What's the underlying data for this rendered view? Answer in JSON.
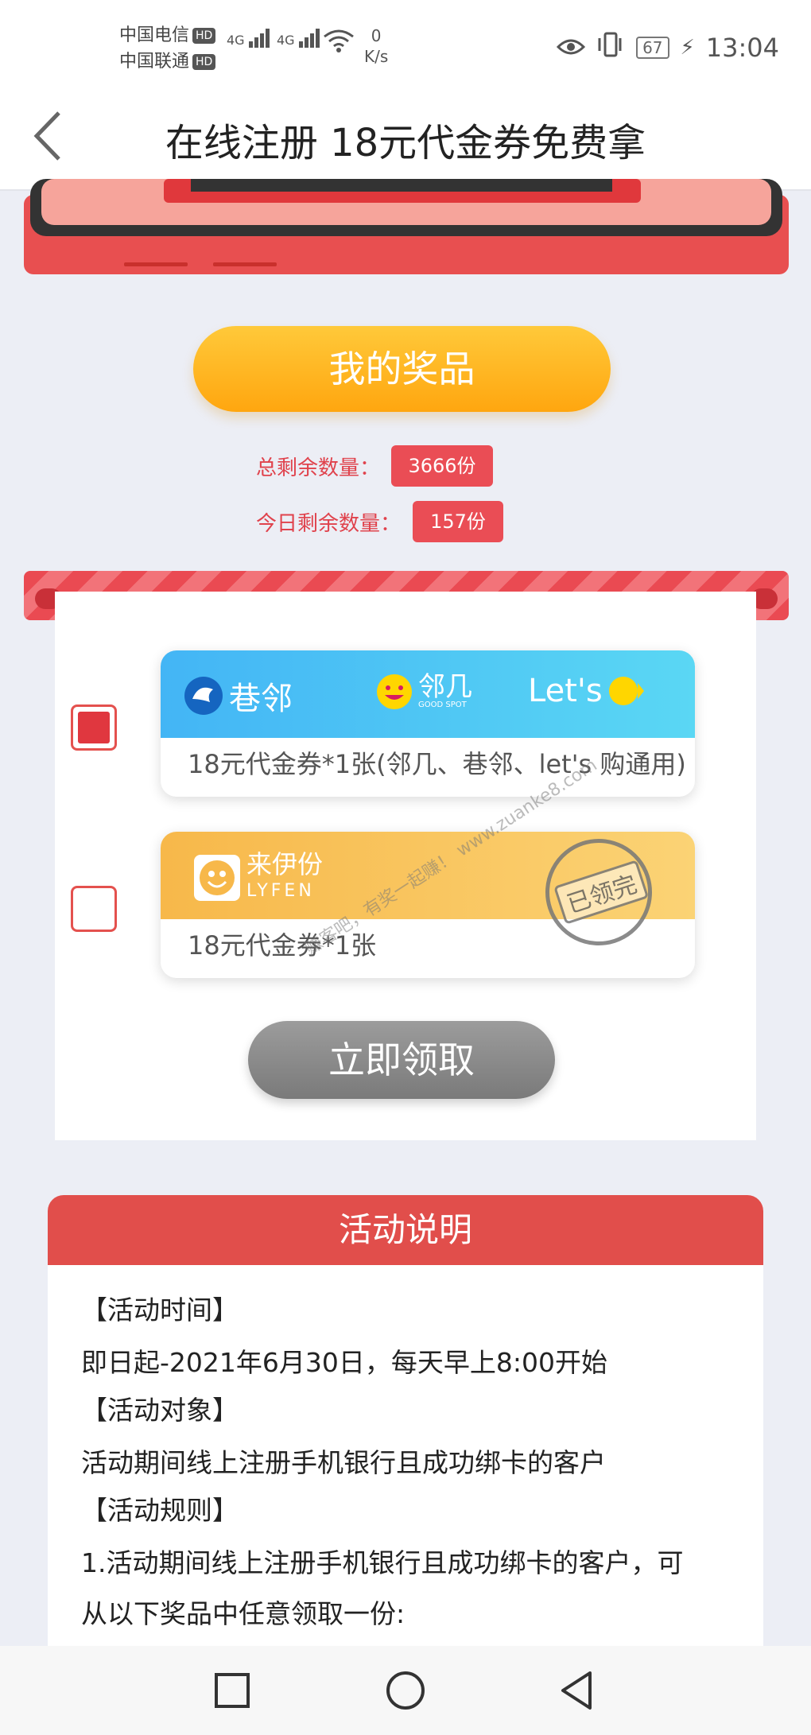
{
  "status_bar": {
    "carrier1": "中国电信",
    "carrier2": "中国联通",
    "hd": "HD",
    "net1": "4G",
    "net2": "4G",
    "speed_value": "0",
    "speed_unit": "K/s",
    "battery": "67",
    "time": "13:04"
  },
  "nav": {
    "title": "在线注册 18元代金券免费拿"
  },
  "prize_button": "我的奖品",
  "stats": {
    "total_label": "总剩余数量：",
    "total_value": "3666份",
    "today_label": "今日剩余数量：",
    "today_value": "157份"
  },
  "coupons": [
    {
      "checked": true,
      "logos": [
        "巷邻",
        "邻几",
        "Let's"
      ],
      "sub_logo": "GOOD SPOT",
      "desc": "18元代金券*1张(邻几、巷邻、let's 购通用)",
      "color": "#4fc3f7"
    },
    {
      "checked": false,
      "logo": "来伊份",
      "logo_en": "LYFEN",
      "desc": "18元代金券*1张",
      "stamp": "已领完",
      "color": "#f9c14c"
    }
  ],
  "watermark": "赚客吧，有奖一起赚！ www.zuanke8.com",
  "claim_button": "立即领取",
  "rules": {
    "title": "活动说明",
    "lines": [
      "【活动时间】",
      "即日起-2021年6月30日，每天早上8:00开始",
      "【活动对象】",
      "活动期间线上注册手机银行且成功绑卡的客户",
      "【活动规则】",
      "1.活动期间线上注册手机银行且成功绑卡的客户，可",
      "从以下奖品中任意领取一份:"
    ]
  },
  "colors": {
    "accent_red": "#e14e4b",
    "orange": "#ffa60f",
    "stat_red": "#e0424c"
  }
}
